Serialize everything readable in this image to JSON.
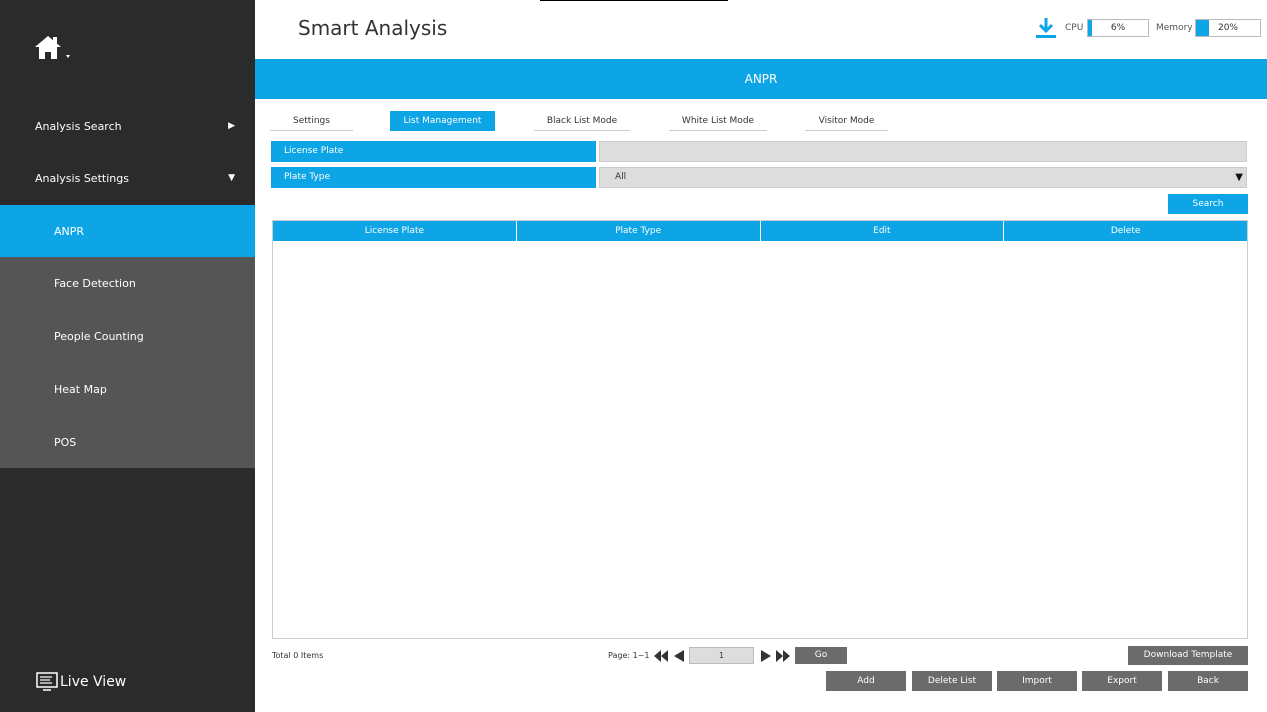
{
  "sidebar": {
    "items": [
      {
        "label": "Analysis Search",
        "arrow": "▶"
      },
      {
        "label": "Analysis Settings",
        "arrow": "▼"
      }
    ],
    "sub_items": [
      "ANPR",
      "Face Detection",
      "People Counting",
      "Heat Map",
      "POS"
    ],
    "active_sub_item": "ANPR",
    "live_view": "Live View"
  },
  "header": {
    "title": "Smart Analysis",
    "cpu_label": "CPU",
    "cpu_value": "6%",
    "memory_label": "Memory",
    "memory_value": "20%"
  },
  "banner": "ANPR",
  "tabs": [
    "Settings",
    "List Management",
    "Black List Mode",
    "White List Mode",
    "Visitor Mode"
  ],
  "active_tab": "List Management",
  "form": {
    "license_plate_label": "License Plate",
    "license_plate_value": "",
    "plate_type_label": "Plate Type",
    "plate_type_value": "All"
  },
  "search_button": "Search",
  "table": {
    "columns": [
      "License Plate",
      "Plate Type",
      "Edit",
      "Delete"
    ],
    "rows": []
  },
  "footer": {
    "total": "Total 0 Items",
    "page": "Page: 1~1",
    "page_input": "1",
    "go": "Go",
    "download_template": "Download Template",
    "actions": [
      "Add",
      "Delete List",
      "Import",
      "Export",
      "Back"
    ]
  },
  "colors": {
    "accent": "#0ea5e6",
    "sidebar": "#2b2b2b",
    "sidebar_sub": "#555555",
    "button_gray": "#6b6b6b"
  }
}
